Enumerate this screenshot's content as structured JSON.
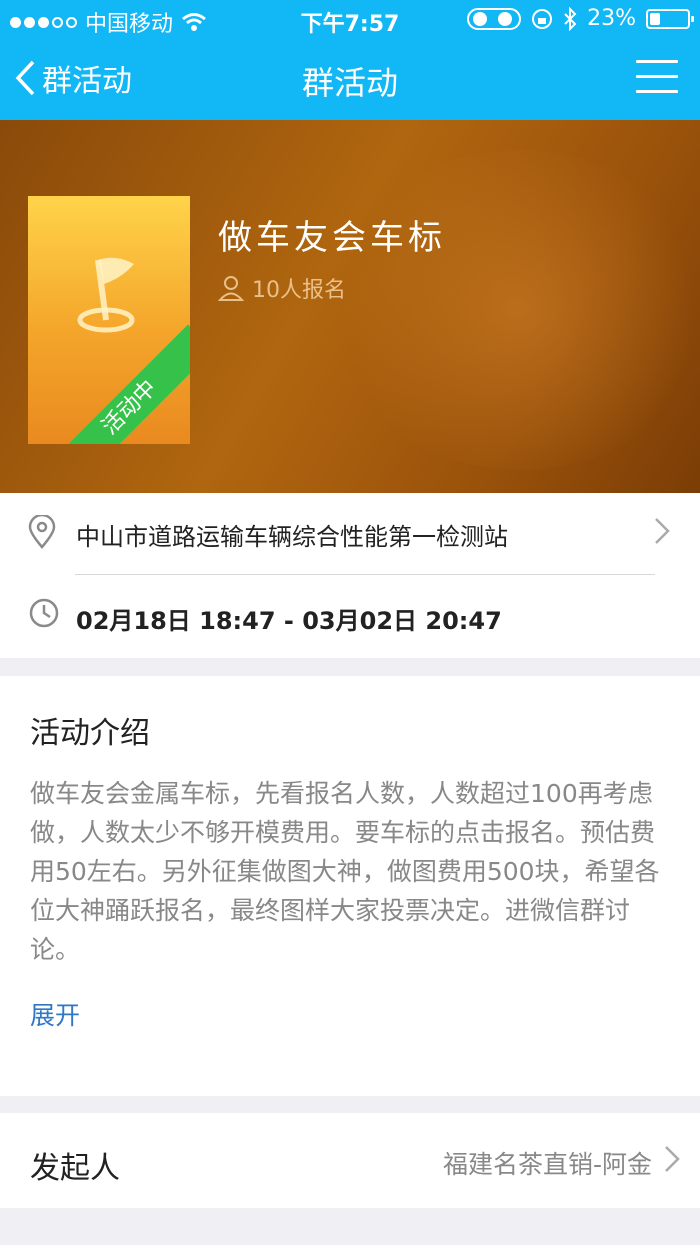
{
  "status_bar": {
    "carrier": "中国移动",
    "time": "下午7:57",
    "battery": "23%",
    "battery_level": 0.23
  },
  "nav": {
    "back_label": "群活动",
    "title": "群活动"
  },
  "hero": {
    "title": "做车友会车标",
    "signup_count": "10人报名",
    "poster_badge": "活动中"
  },
  "info": {
    "location": "中山市道路运输车辆综合性能第一检测站",
    "time_range": "02月18日 18:47 - 03月02日 20:47"
  },
  "intro": {
    "heading": "活动介绍",
    "body": "做车友会金属车标，先看报名人数，人数超过100再考虑做，人数太少不够开模费用。要车标的点击报名。预估费用50左右。另外征集做图大神，做图费用500块，希望各位大神踊跃报名，最终图样大家投票决定。进微信群讨论。",
    "expand_label": "展开"
  },
  "initiator": {
    "label": "发起人",
    "value": "福建名茶直销-阿金"
  },
  "colors": {
    "nav_blue": "#12b7f5",
    "badge_green": "#36c24a",
    "link_blue": "#2e78c7"
  }
}
